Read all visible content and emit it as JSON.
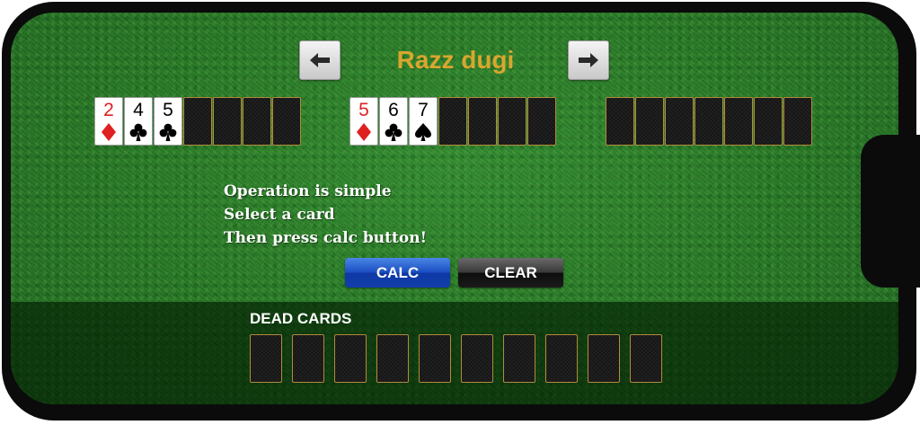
{
  "header": {
    "title": "Razz dugi",
    "prev_icon": "arrow-left-icon",
    "next_icon": "arrow-right-icon"
  },
  "colors": {
    "title": "#d9a62e",
    "felt": "#237621",
    "red_suit": "#e02020",
    "black_suit": "#000000",
    "calc_button": "#1c4fc2",
    "clear_button": "#0d0d0d",
    "card_back_border": "#b28a3d"
  },
  "hands": [
    {
      "cards": [
        {
          "rank": "2",
          "suit": "diamond",
          "color": "red"
        },
        {
          "rank": "4",
          "suit": "club",
          "color": "black"
        },
        {
          "rank": "5",
          "suit": "club",
          "color": "black"
        },
        {
          "rank": "",
          "suit": "",
          "color": ""
        },
        {
          "rank": "",
          "suit": "",
          "color": ""
        },
        {
          "rank": "",
          "suit": "",
          "color": ""
        },
        {
          "rank": "",
          "suit": "",
          "color": ""
        }
      ]
    },
    {
      "cards": [
        {
          "rank": "5",
          "suit": "diamond",
          "color": "red"
        },
        {
          "rank": "6",
          "suit": "club",
          "color": "black"
        },
        {
          "rank": "7",
          "suit": "spade",
          "color": "black"
        },
        {
          "rank": "",
          "suit": "",
          "color": ""
        },
        {
          "rank": "",
          "suit": "",
          "color": ""
        },
        {
          "rank": "",
          "suit": "",
          "color": ""
        },
        {
          "rank": "",
          "suit": "",
          "color": ""
        }
      ]
    },
    {
      "cards": [
        {
          "rank": "",
          "suit": "",
          "color": ""
        },
        {
          "rank": "",
          "suit": "",
          "color": ""
        },
        {
          "rank": "",
          "suit": "",
          "color": ""
        },
        {
          "rank": "",
          "suit": "",
          "color": ""
        },
        {
          "rank": "",
          "suit": "",
          "color": ""
        },
        {
          "rank": "",
          "suit": "",
          "color": ""
        },
        {
          "rank": "",
          "suit": "",
          "color": ""
        }
      ]
    }
  ],
  "instructions": {
    "line1": "Operation is simple",
    "line2": "Select a card",
    "line3": "Then press calc button!"
  },
  "buttons": {
    "calc_label": "CALC",
    "clear_label": "CLEAR"
  },
  "dead_cards": {
    "label": "DEAD CARDS",
    "slots": 10
  }
}
